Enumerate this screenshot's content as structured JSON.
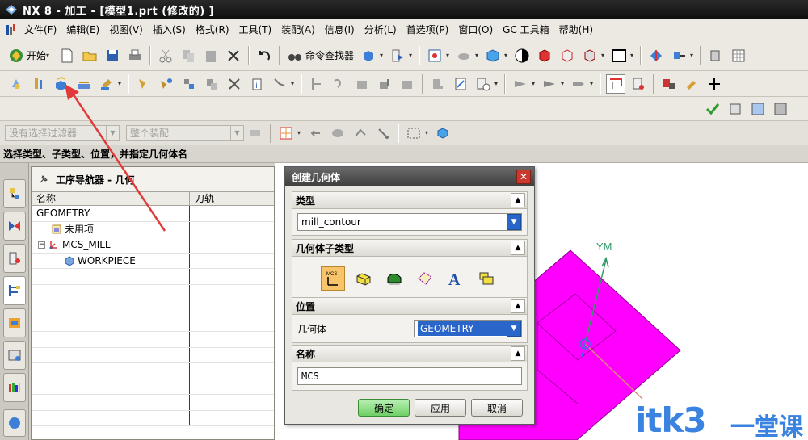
{
  "window": {
    "title": "NX 8 - 加工 - [模型1.prt  (修改的) ]"
  },
  "menubar": {
    "items": [
      "文件(F)",
      "编辑(E)",
      "视图(V)",
      "插入(S)",
      "格式(R)",
      "工具(T)",
      "装配(A)",
      "信息(I)",
      "分析(L)",
      "首选项(P)",
      "窗口(O)",
      "GC 工具箱",
      "帮助(H)"
    ]
  },
  "toolbar": {
    "start_label": "开始",
    "command_finder_label": "命令查找器"
  },
  "selection_bar": {
    "filter_value": "没有选择过滤器",
    "assembly_value": "整个装配"
  },
  "cue_line": "选择类型、子类型、位置，并指定几何体名",
  "navigator": {
    "title": "工序导航器 - 几何",
    "col_name": "名称",
    "col_toolpath": "刀轨",
    "rows": [
      {
        "label": "GEOMETRY",
        "indent": 0
      },
      {
        "label": "未用项",
        "indent": 1
      },
      {
        "label": "MCS_MILL",
        "indent": 1
      },
      {
        "label": "WORKPIECE",
        "indent": 2
      }
    ]
  },
  "dialog": {
    "title": "创建几何体",
    "type_group": "类型",
    "type_value": "mill_contour",
    "subtype_group": "几何体子类型",
    "location_group": "位置",
    "geometry_label": "几何体",
    "geometry_value": "GEOMETRY",
    "name_group": "名称",
    "name_value": "MCS",
    "ok_label": "确定",
    "apply_label": "应用",
    "cancel_label": "取消"
  },
  "viewport": {
    "axis_label": "YM",
    "part_color": "#ff00ff"
  },
  "watermark": {
    "text": "itk3",
    "text_cn": "一堂课"
  }
}
